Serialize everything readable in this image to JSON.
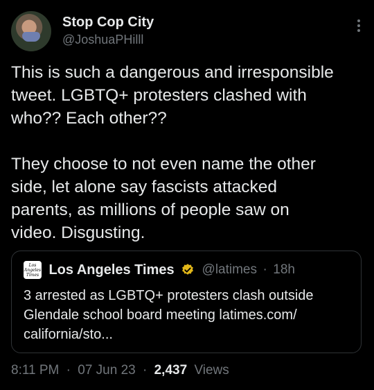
{
  "author": {
    "display_name": "Stop Cop City",
    "handle": "@JoshuaPHilll"
  },
  "tweet": {
    "text": "This is such a dangerous and irresponsible\ntweet. LGBTQ+ protesters clashed with\nwho?? Each other??\n\nThey choose to not even name the other\nside, let alone say fascists attacked\nparents, as millions of people saw on\nvideo. Disgusting."
  },
  "quoted_tweet": {
    "logo_text": "Los Angeles Times",
    "display_name": "Los Angeles Times",
    "handle": "@latimes",
    "separator": "·",
    "time": "18h",
    "text": "3 arrested as LGBTQ+ protesters clash outside\nGlendale school board meeting latimes.com/\ncalifornia/sto...",
    "verified_color": "#e2b719"
  },
  "meta": {
    "time": "8:11 PM",
    "separator1": "·",
    "date": "07 Jun 23",
    "separator2": "·",
    "views_count": "2,437",
    "views_label": "Views"
  },
  "icons": {
    "more": "more-vertical-icon",
    "verified": "verified-badge-icon"
  }
}
